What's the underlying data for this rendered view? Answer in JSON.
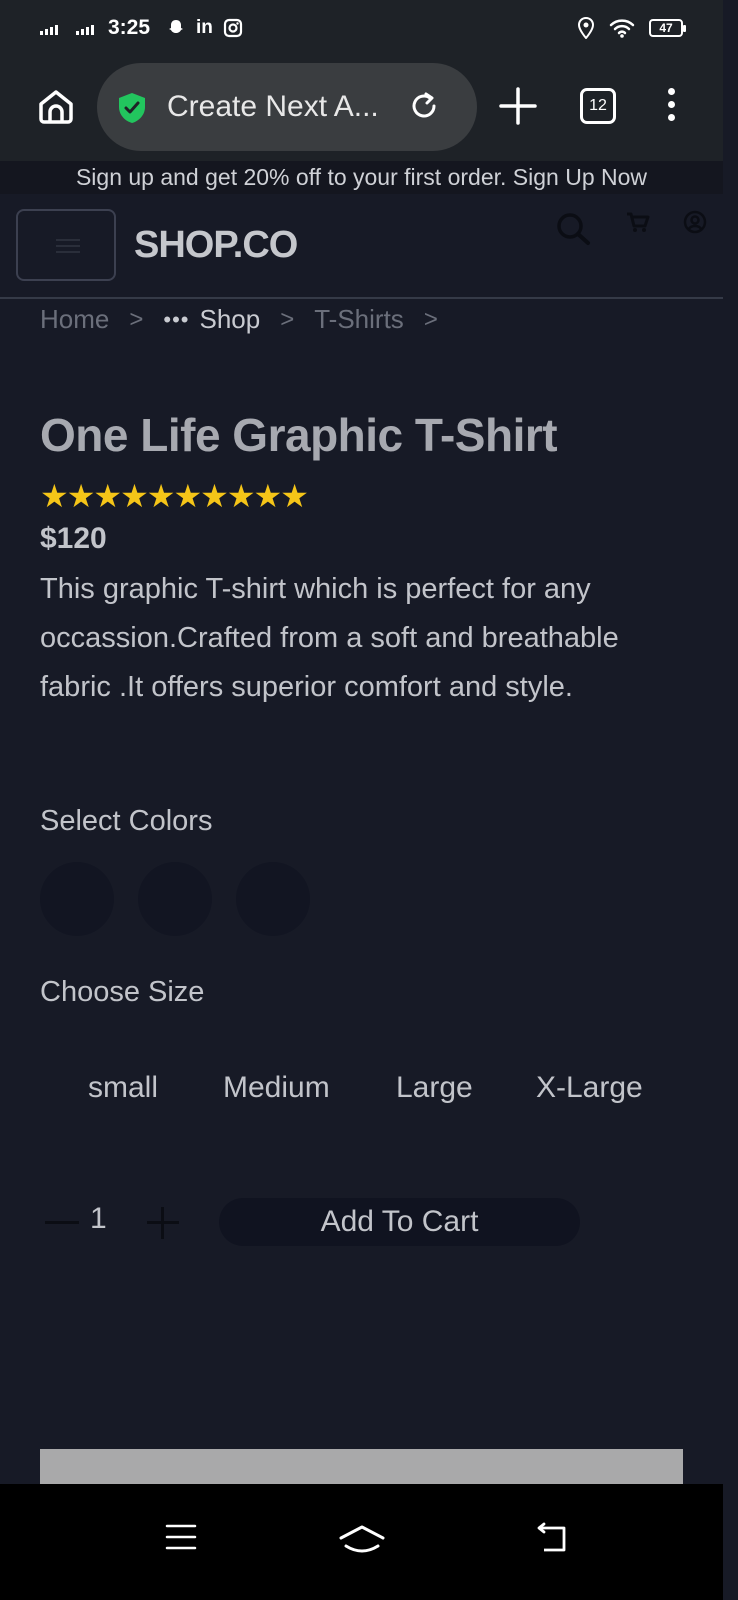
{
  "status_bar": {
    "time": "3:25",
    "notification_icons": [
      "snapchat-icon",
      "linkedin-icon",
      "instagram-icon"
    ],
    "linkedin_text": "in",
    "battery": "47"
  },
  "browser": {
    "url_title": "Create Next A...",
    "tab_count": "12",
    "secure_color": "#22c55e"
  },
  "promo": {
    "text": "Sign up and get 20% off to your first order.",
    "link": "Sign Up Now"
  },
  "header": {
    "logo": "SHOP.CO",
    "icons": [
      "search-icon",
      "cart-icon",
      "account-icon"
    ]
  },
  "breadcrumb": {
    "home": "Home",
    "ellipsis": "•••",
    "shop": "Shop",
    "category": "T-Shirts",
    "separator": ">"
  },
  "product": {
    "title": "One Life Graphic T-Shirt",
    "stars": "★★★★★★★★★★",
    "rating_count": 10,
    "price": "$120",
    "description": "This graphic T-shirt which is perfect for any occassion.Crafted from a soft and breathable fabric .It offers superior comfort and style.",
    "colors_label": "Select Colors",
    "colors": [
      "#121522",
      "#121522",
      "#121522"
    ],
    "size_label": "Choose Size",
    "sizes": [
      "small",
      "Medium",
      "Large",
      "X-Large"
    ],
    "quantity": "1",
    "add_to_cart": "Add To Cart"
  },
  "colors": {
    "background": "#171a26",
    "star": "#f5c518"
  }
}
